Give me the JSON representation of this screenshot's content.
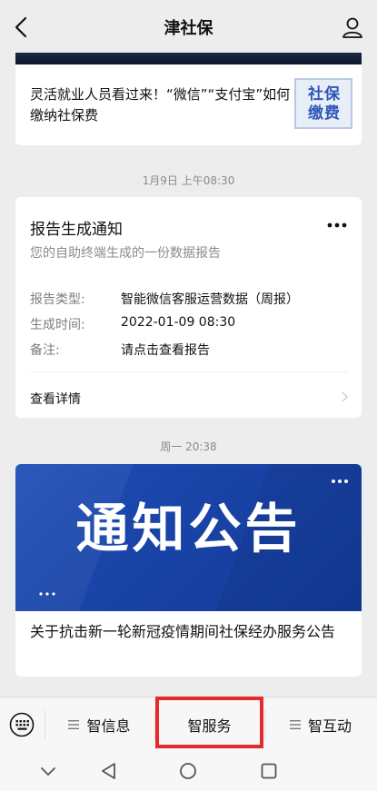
{
  "header": {
    "title": "津社保",
    "back_icon": "back-chevron-icon",
    "profile_icon": "person-icon"
  },
  "article": {
    "headline": "灵活就业人员看过来！“微信”“支付宝”如何缴纳社保费",
    "thumb_line1": "社保",
    "thumb_line2": "缴费"
  },
  "timestamps": [
    "1月9日 上午08:30",
    "周一 20:38"
  ],
  "report": {
    "title": "报告生成通知",
    "subtitle": "您的自助终端生成的一份数据报告",
    "rows": [
      {
        "label": "报告类型:",
        "value": "智能微信客服运营数据（周报）"
      },
      {
        "label": "生成时间:",
        "value": "2022-01-09 08:30"
      },
      {
        "label": "备注:",
        "value": "请点击查看报告"
      }
    ],
    "detail_link": "查看详情"
  },
  "announcement": {
    "banner_text": "通知公告",
    "caption": "关于抗击新一轮新冠疫情期间社保经办服务公告"
  },
  "bottom_menu": {
    "items": [
      {
        "label": "智信息",
        "has_menu_icon": true
      },
      {
        "label": "智服务",
        "has_menu_icon": false,
        "highlighted": true
      },
      {
        "label": "智互动",
        "has_menu_icon": true
      }
    ]
  },
  "colors": {
    "highlight": "#e32b2b",
    "banner_blue": "#1943a6",
    "background": "#ededed"
  }
}
